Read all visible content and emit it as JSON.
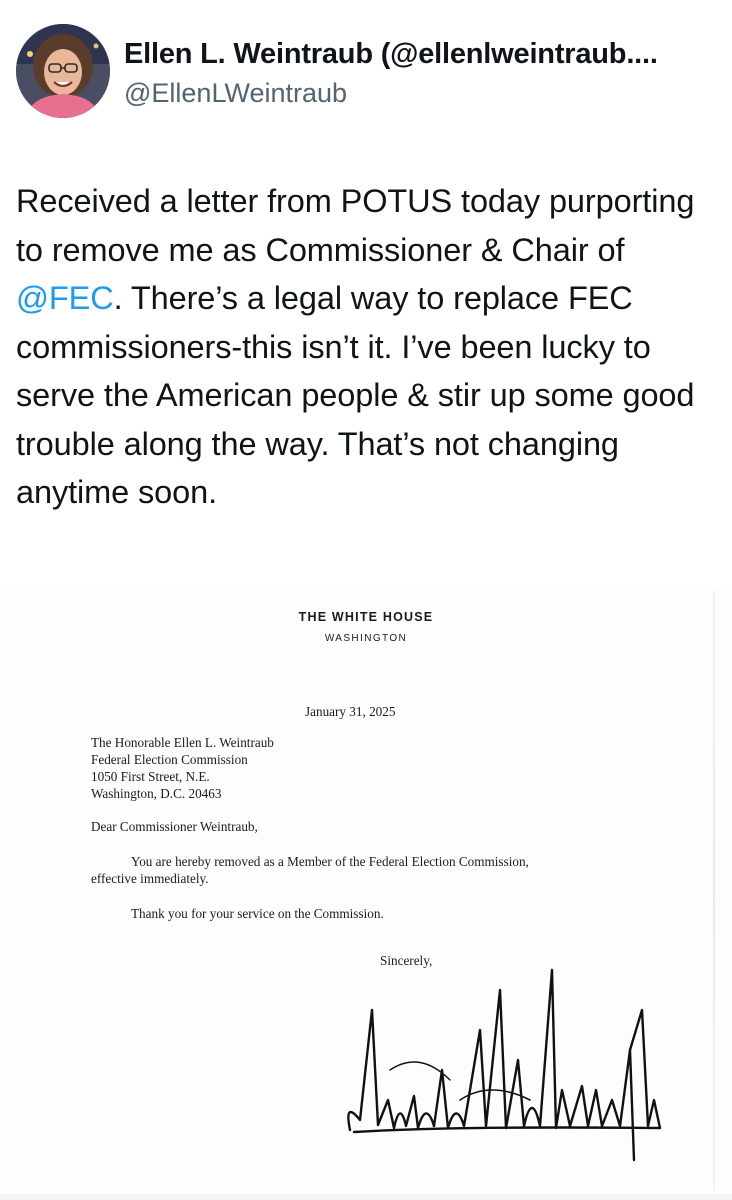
{
  "author": {
    "display_name": "Ellen L. Weintraub (@ellenlweintraub....",
    "handle": "@EllenLWeintraub"
  },
  "tweet": {
    "text_part1": "Received a letter from POTUS today purporting to remove me as Commissioner & Chair of ",
    "mention": "@FEC",
    "text_part2": ". There’s a legal way to replace FEC commissioners-this isn’t it. I’ve been lucky to serve the American people & stir up some good trouble along the way. That’s not changing anytime soon."
  },
  "letter": {
    "heading": "THE WHITE HOUSE",
    "subheading": "WASHINGTON",
    "date": "January 31, 2025",
    "address": [
      "The Honorable Ellen L. Weintraub",
      "Federal Election Commission",
      "1050 First Street, N.E.",
      "Washington, D.C. 20463"
    ],
    "salutation": "Dear Commissioner Weintraub,",
    "body_line1": "You are hereby removed as a Member of the Federal Election Commission,",
    "body_line2": "effective immediately.",
    "body_line3": "Thank you for your service on the Commission.",
    "closing": "Sincerely,"
  }
}
